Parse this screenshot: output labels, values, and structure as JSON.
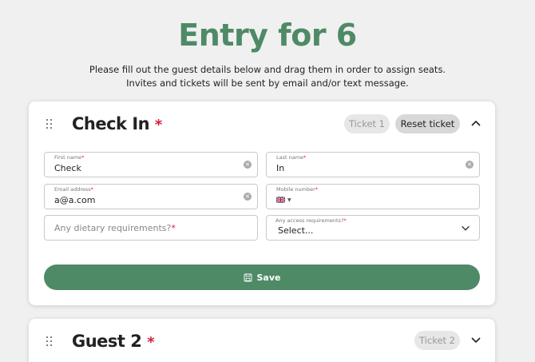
{
  "page": {
    "title": "Entry for 6",
    "subtitle": "Please fill out the guest details below and drag them in order to assign seats. Invites and tickets will be sent by email and/or text message."
  },
  "guests": [
    {
      "name": "Check In",
      "required_mark": "*",
      "ticket_label": "Ticket 1",
      "reset_label": "Reset ticket",
      "expanded": true,
      "fields": {
        "first_name": {
          "label": "First name",
          "value": "Check"
        },
        "last_name": {
          "label": "Last name",
          "value": "In"
        },
        "email": {
          "label": "Email address",
          "value": "a@a.com"
        },
        "mobile": {
          "label": "Mobile number",
          "value": ""
        },
        "dietary": {
          "placeholder": "Any dietary requirements?"
        },
        "access": {
          "label": "Any access requirements?",
          "value": "Select..."
        }
      },
      "save_label": "Save"
    },
    {
      "name": "Guest 2",
      "required_mark": "*",
      "ticket_label": "Ticket 2",
      "expanded": false
    }
  ],
  "icons": {
    "drag": "drag-handle-icon",
    "collapse": "chevron-up-icon",
    "expand": "chevron-down-icon",
    "clear": "clear-icon",
    "flag": "uk-flag-icon",
    "save": "save-icon"
  },
  "colors": {
    "accent": "#4e8a66",
    "required": "#d4203c"
  }
}
